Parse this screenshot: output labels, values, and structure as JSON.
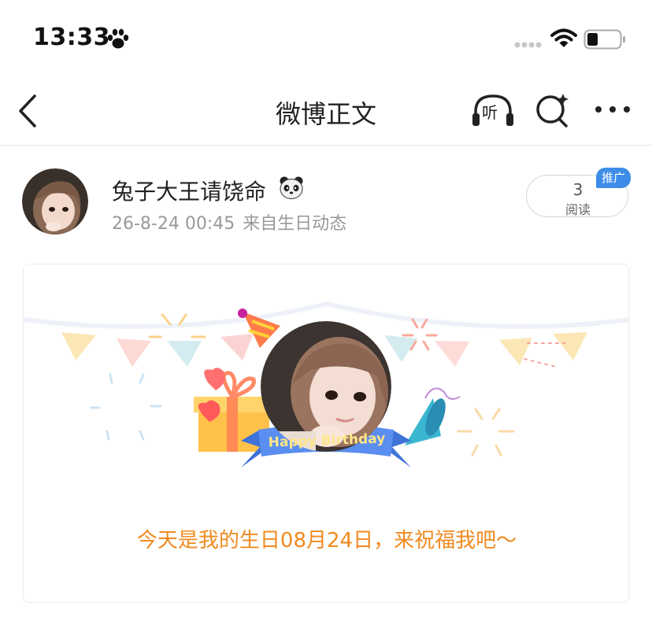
{
  "status_bar": {
    "time": "13:33"
  },
  "nav": {
    "title": "微博正文",
    "listen_label": "听"
  },
  "post": {
    "username": "兔子大王请饶命",
    "date": "26-8-24 00:45",
    "source": "来自生日动态",
    "read_count": "3",
    "read_label": "阅读",
    "promo_badge": "推广"
  },
  "card": {
    "banner_text": "Happy Birthday",
    "message": "今天是我的生日08月24日，来祝福我吧～"
  },
  "colors": {
    "accent_orange": "#f08a1f",
    "badge_blue": "#3d8de8",
    "ribbon_blue": "#4a7de0"
  }
}
